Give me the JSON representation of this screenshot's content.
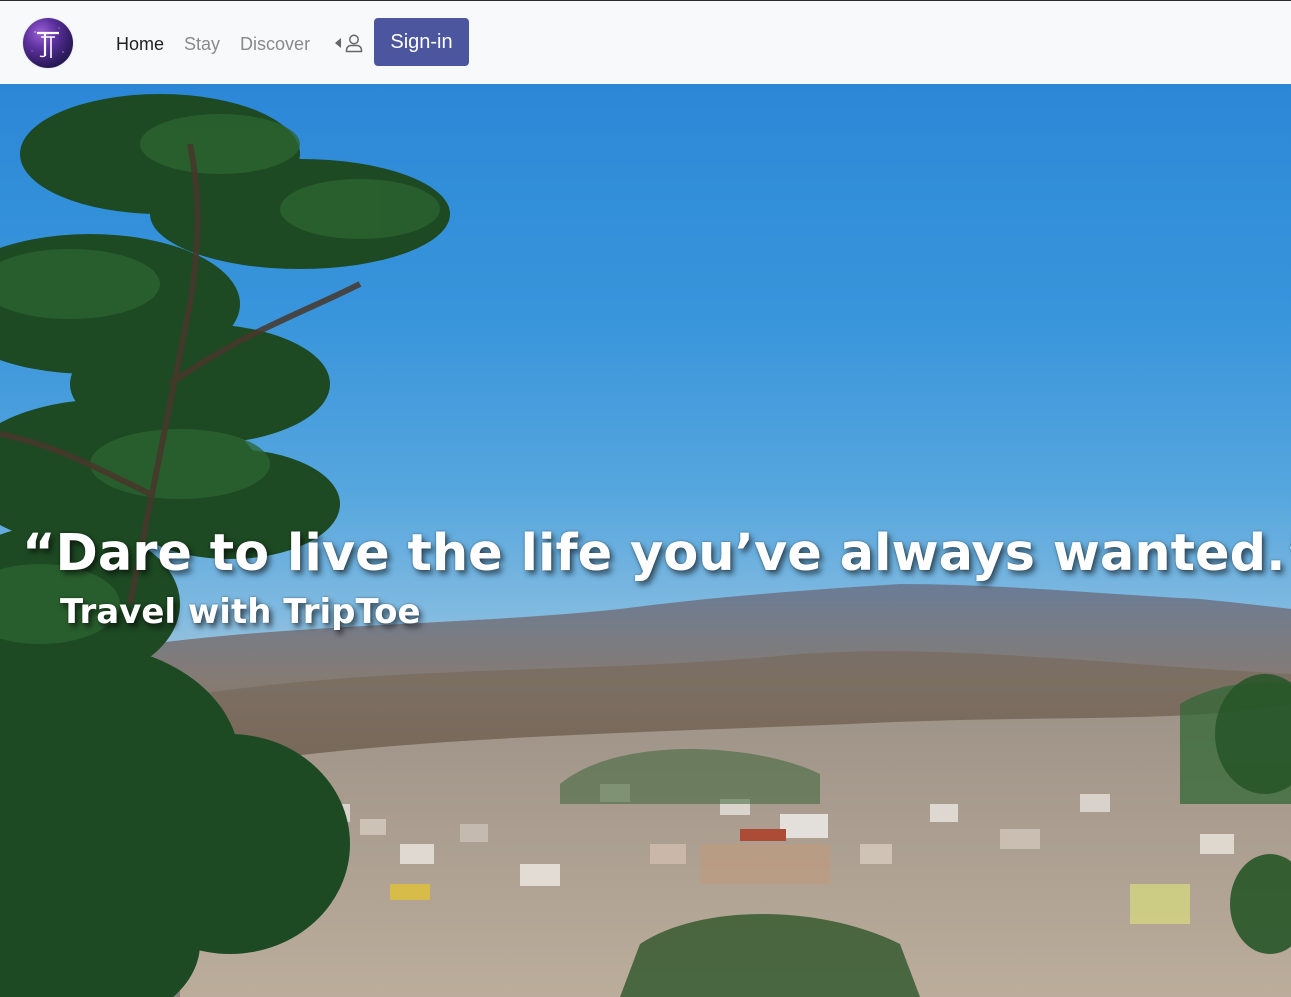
{
  "nav": {
    "items": [
      {
        "label": "Home",
        "active": true
      },
      {
        "label": "Stay",
        "active": false
      },
      {
        "label": "Discover",
        "active": false
      }
    ],
    "signin_label": "Sign-in"
  },
  "hero": {
    "quote": "“Dare to live the life you’ve always wanted.”",
    "tagline": "Travel with TripToe"
  },
  "colors": {
    "navbar_bg": "#f8f9fa",
    "signin_bg": "#4b569e",
    "logo": "#5a2f9a"
  }
}
